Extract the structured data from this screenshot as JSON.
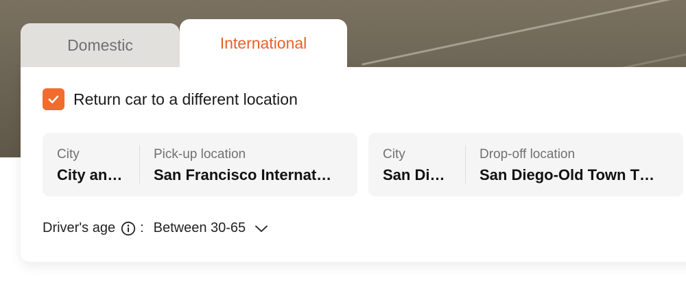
{
  "tabs": [
    {
      "label": "Domestic"
    },
    {
      "label": "International"
    }
  ],
  "return_checkbox": {
    "label": "Return car to a different location"
  },
  "pickup": {
    "city_label": "City",
    "city_value": "City an…",
    "location_label": "Pick-up location",
    "location_value": "San Francisco Internat…"
  },
  "dropoff": {
    "city_label": "City",
    "city_value": "San Di…",
    "location_label": "Drop-off location",
    "location_value": "San Diego-Old Town T…"
  },
  "driver_age": {
    "label": "Driver's age",
    "colon": ":",
    "value": "Between 30-65"
  },
  "icons": {
    "checkbox": "check-icon",
    "info": "info-icon",
    "dropdown": "chevron-down-icon"
  },
  "colors": {
    "accent": "#f26b2f",
    "active_tab_text": "#e8612a",
    "inactive_tab_bg": "#e2e0dd"
  }
}
